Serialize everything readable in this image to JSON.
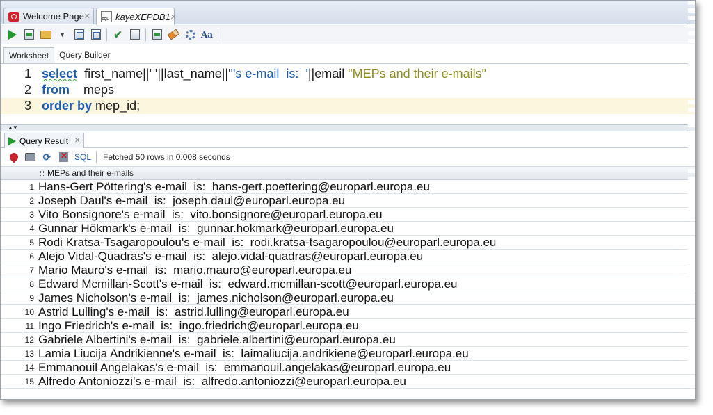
{
  "doc_tabs": [
    {
      "label": "Welcome Page",
      "close": "✕",
      "icon": "oracle-icon"
    },
    {
      "label": "kayeXEPDB1",
      "close": "✕",
      "icon": "sql-worksheet-icon"
    }
  ],
  "worksheet_tabs": [
    "Worksheet",
    "Query Builder"
  ],
  "editor": {
    "lines": [
      {
        "number": "1",
        "keyword": "select",
        "text_a": "first_name||' '||last_name||'",
        "string": "''s e-mail  is:  '",
        "text_b": "||email ",
        "alias": "\"MEPs and their e-mails\""
      },
      {
        "number": "2",
        "keyword": "from",
        "text": "meps"
      },
      {
        "number": "3",
        "keyword": "order by",
        "text": "mep_id;"
      }
    ]
  },
  "splitter": {
    "arrows": "▲▼"
  },
  "result": {
    "tab_label": "Query Result",
    "tab_close": "✕",
    "sql_label": "SQL",
    "status": "Fetched 50 rows in 0.008 seconds",
    "column_header": "MEPs and their e-mails",
    "rows": [
      {
        "n": "1",
        "value": "Hans-Gert Pöttering's e-mail  is:  hans-gert.poettering@europarl.europa.eu"
      },
      {
        "n": "2",
        "value": "Joseph Daul's e-mail  is:  joseph.daul@europarl.europa.eu"
      },
      {
        "n": "3",
        "value": "Vito Bonsignore's e-mail  is:  vito.bonsignore@europarl.europa.eu"
      },
      {
        "n": "4",
        "value": "Gunnar Hökmark's e-mail  is:  gunnar.hokmark@europarl.europa.eu"
      },
      {
        "n": "5",
        "value": "Rodi Kratsa-Tsagaropoulou's e-mail  is:  rodi.kratsa-tsagaropoulou@europarl.europa.eu"
      },
      {
        "n": "6",
        "value": "Alejo Vidal-Quadras's e-mail  is:  alejo.vidal-quadras@europarl.europa.eu"
      },
      {
        "n": "7",
        "value": "Mario Mauro's e-mail  is:  mario.mauro@europarl.europa.eu"
      },
      {
        "n": "8",
        "value": "Edward Mcmillan-Scott's e-mail  is:  edward.mcmillan-scott@europarl.europa.eu"
      },
      {
        "n": "9",
        "value": "James Nicholson's e-mail  is:  james.nicholson@europarl.europa.eu"
      },
      {
        "n": "10",
        "value": "Astrid Lulling's e-mail  is:  astrid.lulling@europarl.europa.eu"
      },
      {
        "n": "11",
        "value": "Ingo Friedrich's e-mail  is:  ingo.friedrich@europarl.europa.eu"
      },
      {
        "n": "12",
        "value": "Gabriele Albertini's e-mail  is:  gabriele.albertini@europarl.europa.eu"
      },
      {
        "n": "13",
        "value": "Lamia Liucija Andrikienne's e-mail  is:  laimaliucija.andrikiene@europarl.europa.eu"
      },
      {
        "n": "14",
        "value": "Emmanouil Angelakas's e-mail  is:  emmanouil.angelakas@europarl.europa.eu"
      },
      {
        "n": "15",
        "value": "Alfredo Antoniozzi's e-mail  is:  alfredo.antoniozzi@europarl.europa.eu"
      }
    ]
  },
  "colors": {
    "keyword": "#1c5bb4",
    "alias": "#8c8c1a",
    "current_line": "#fbf6dd",
    "run_green": "#1f9d2c",
    "oracle_red": "#d3222a"
  }
}
